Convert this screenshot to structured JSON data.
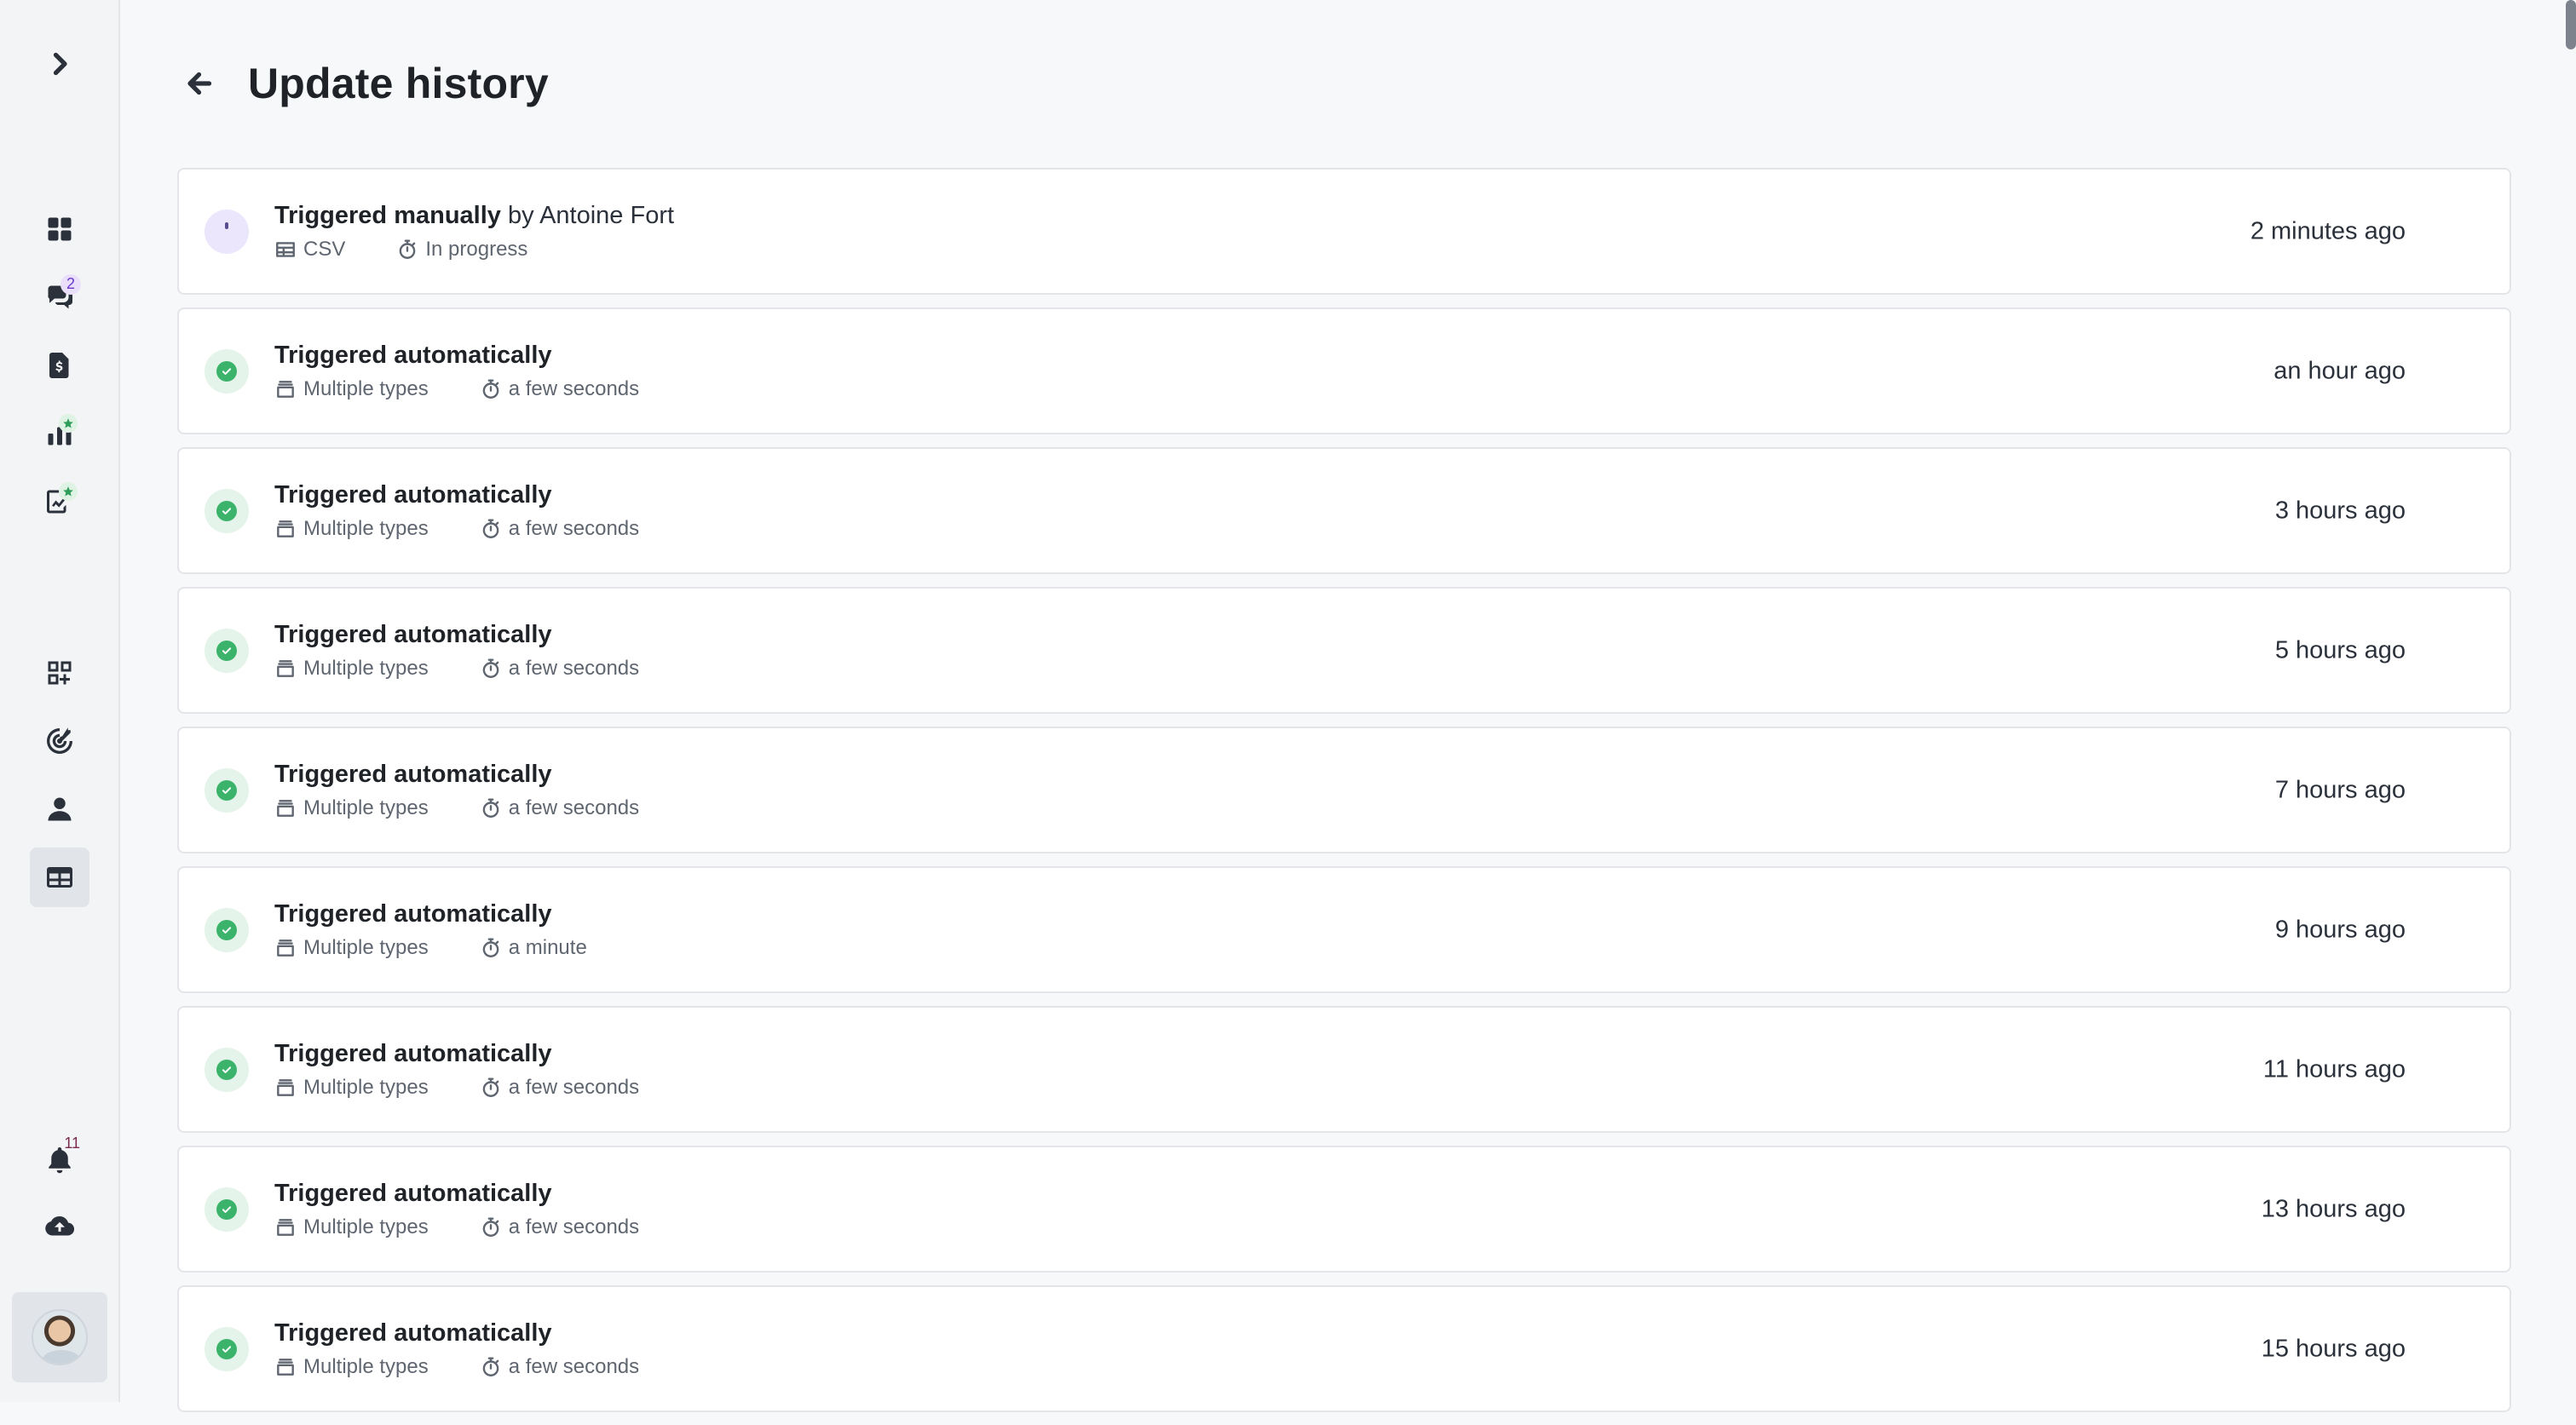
{
  "sidebar": {
    "messages_badge": "2",
    "notifications_badge": "11",
    "icons": [
      "chevron-right-icon",
      "dashboard-icon",
      "chat-icon",
      "invoice-icon",
      "analytics-icon",
      "reports-icon",
      "widgets-icon",
      "target-icon",
      "person-icon",
      "table-icon",
      "bell-icon",
      "cloud-upload-icon"
    ]
  },
  "header": {
    "title": "Update history"
  },
  "history": [
    {
      "status": "in-progress",
      "title": "Triggered manually",
      "by": "by Antoine Fort",
      "source": "CSV",
      "source_icon": "table-icon",
      "duration": "In progress",
      "time": "2 minutes ago"
    },
    {
      "status": "success",
      "title": "Triggered automatically",
      "by": "",
      "source": "Multiple types",
      "source_icon": "stack-icon",
      "duration": "a few seconds",
      "time": "an hour ago"
    },
    {
      "status": "success",
      "title": "Triggered automatically",
      "by": "",
      "source": "Multiple types",
      "source_icon": "stack-icon",
      "duration": "a few seconds",
      "time": "3 hours ago"
    },
    {
      "status": "success",
      "title": "Triggered automatically",
      "by": "",
      "source": "Multiple types",
      "source_icon": "stack-icon",
      "duration": "a few seconds",
      "time": "5 hours ago"
    },
    {
      "status": "success",
      "title": "Triggered automatically",
      "by": "",
      "source": "Multiple types",
      "source_icon": "stack-icon",
      "duration": "a few seconds",
      "time": "7 hours ago"
    },
    {
      "status": "success",
      "title": "Triggered automatically",
      "by": "",
      "source": "Multiple types",
      "source_icon": "stack-icon",
      "duration": "a minute",
      "time": "9 hours ago"
    },
    {
      "status": "success",
      "title": "Triggered automatically",
      "by": "",
      "source": "Multiple types",
      "source_icon": "stack-icon",
      "duration": "a few seconds",
      "time": "11 hours ago"
    },
    {
      "status": "success",
      "title": "Triggered automatically",
      "by": "",
      "source": "Multiple types",
      "source_icon": "stack-icon",
      "duration": "a few seconds",
      "time": "13 hours ago"
    },
    {
      "status": "success",
      "title": "Triggered automatically",
      "by": "",
      "source": "Multiple types",
      "source_icon": "stack-icon",
      "duration": "a few seconds",
      "time": "15 hours ago"
    }
  ]
}
